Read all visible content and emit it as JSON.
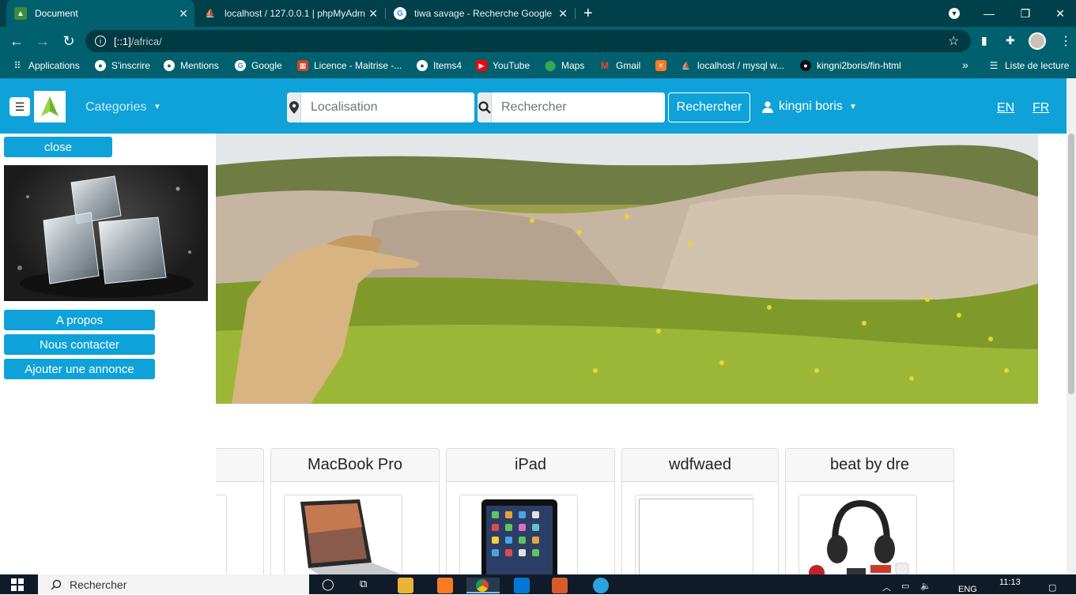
{
  "browser": {
    "tabs": [
      {
        "title": "Document",
        "active": true,
        "icon": "site-favicon"
      },
      {
        "title": "localhost / 127.0.0.1 | phpMyAdm",
        "active": false,
        "icon": "phpmyadmin-icon"
      },
      {
        "title": "tiwa savage - Recherche Google",
        "active": false,
        "icon": "google-icon"
      }
    ],
    "new_tab": "+",
    "url_host": "[::1]",
    "url_path": "/africa/"
  },
  "bookmarks": [
    {
      "label": "Applications",
      "icon": "apps-grid-icon"
    },
    {
      "label": "S'inscrire",
      "icon": "globe-icon"
    },
    {
      "label": "Mentions",
      "icon": "globe-icon"
    },
    {
      "label": "Google",
      "icon": "google-icon"
    },
    {
      "label": "Licence - Maitrise -...",
      "icon": "licence-icon"
    },
    {
      "label": "Items4",
      "icon": "globe-icon"
    },
    {
      "label": "YouTube",
      "icon": "youtube-icon"
    },
    {
      "label": "Maps",
      "icon": "maps-icon"
    },
    {
      "label": "Gmail",
      "icon": "gmail-icon"
    },
    {
      "label": "",
      "icon": "xampp-icon"
    },
    {
      "label": "localhost / mysql w...",
      "icon": "phpmyadmin-icon"
    },
    {
      "label": "kingni2boris/fin-html",
      "icon": "github-icon"
    }
  ],
  "bookmarks_overflow": "»",
  "reading_list": "Liste de lecture",
  "site": {
    "categories": "Categories",
    "location_placeholder": "Localisation",
    "search_placeholder": "Rechercher",
    "search_button": "Rechercher",
    "user_name": "kingni boris",
    "lang_en": "EN",
    "lang_fr": "FR"
  },
  "sidebar": {
    "close": "close",
    "links": [
      "A propos",
      "Nous contacter",
      "Ajouter une annonce"
    ]
  },
  "products": [
    {
      "title": ""
    },
    {
      "title": "MacBook Pro"
    },
    {
      "title": "iPad"
    },
    {
      "title": "wdfwaed"
    },
    {
      "title": "beat by dre"
    }
  ],
  "taskbar": {
    "search_placeholder": "Rechercher",
    "language": "ENG",
    "time": "11:13"
  }
}
